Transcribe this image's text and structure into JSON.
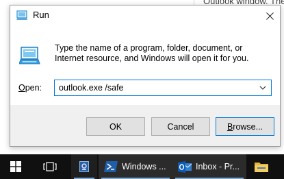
{
  "background": {
    "article_snippet": "Outlook window. The s"
  },
  "dialog": {
    "title": "Run",
    "description": "Type the name of a program, folder, document, or Internet resource, and Windows will open it for you.",
    "open_label_underlined": "O",
    "open_label_rest": "pen:",
    "open_value": "outlook.exe /safe",
    "buttons": {
      "ok": "OK",
      "cancel": "Cancel",
      "browse_underlined": "B",
      "browse_rest": "rowse..."
    }
  },
  "taskbar": {
    "items": [
      {
        "name": "start",
        "icon": "windows-logo-icon"
      },
      {
        "name": "task-view",
        "icon": "task-view-icon"
      },
      {
        "name": "app",
        "icon": "app-icon"
      },
      {
        "name": "powershell",
        "icon": "powershell-icon",
        "label": "Windows ..."
      },
      {
        "name": "outlook",
        "icon": "outlook-icon",
        "label": "Inbox - Pr..."
      },
      {
        "name": "file-explorer",
        "icon": "folder-icon"
      }
    ]
  },
  "colors": {
    "accent": "#0078d7",
    "taskbar": "#101010"
  }
}
